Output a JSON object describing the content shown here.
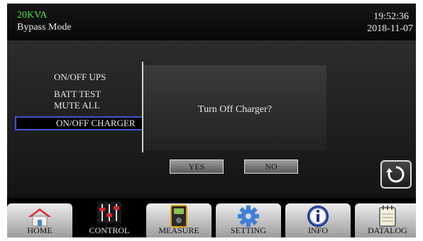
{
  "header": {
    "model": "20KVA",
    "mode": "Bypass Mode",
    "time": "19:52:36",
    "date": "2018-11-07"
  },
  "menu": {
    "items": [
      {
        "label": "ON/OFF UPS"
      },
      {
        "label": "BATT TEST"
      },
      {
        "label": "MUTE ALL"
      },
      {
        "label": "ON/OFF CHARGER",
        "selected": true
      }
    ]
  },
  "dialog": {
    "message": "Turn Off Charger?",
    "yes_label": "YES",
    "no_label": "NO"
  },
  "back_icon": "refresh-icon",
  "nav": {
    "active": "CONTROL",
    "tabs": [
      {
        "label": "HOME",
        "icon": "home-icon"
      },
      {
        "label": "CONTROL",
        "icon": "sliders-icon"
      },
      {
        "label": "MEASURE",
        "icon": "meter-icon"
      },
      {
        "label": "SETTING",
        "icon": "gear-icon"
      },
      {
        "label": "INFO",
        "icon": "info-icon"
      },
      {
        "label": "DATALOG",
        "icon": "notebook-icon"
      }
    ]
  },
  "colors": {
    "model_text": "#49e049",
    "selection_border": "#3b55d0",
    "background": "#000000"
  }
}
